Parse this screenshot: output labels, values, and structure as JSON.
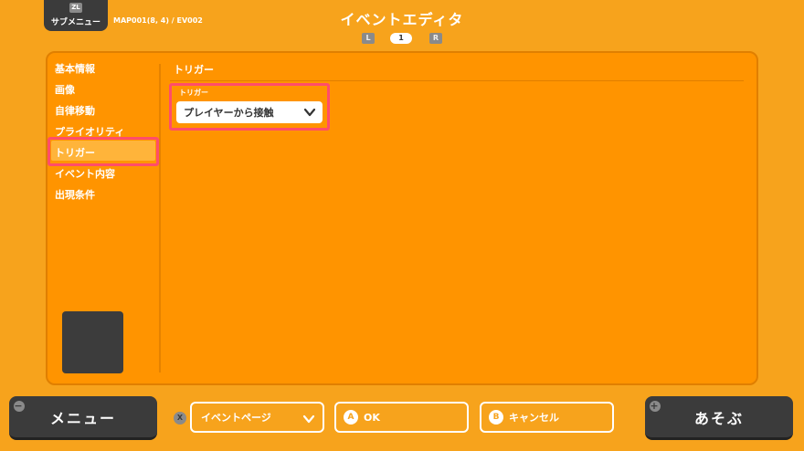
{
  "header": {
    "submenu_key": "ZL",
    "submenu_label": "サブメニュー",
    "map_info": "MAP001(8, 4) / EV002",
    "title": "イベントエディタ",
    "page_prev_key": "L",
    "page_number": "1",
    "page_next_key": "R"
  },
  "sidebar": {
    "items": [
      {
        "label": "基本情報"
      },
      {
        "label": "画像"
      },
      {
        "label": "自律移動"
      },
      {
        "label": "プライオリティ"
      },
      {
        "label": "トリガー"
      },
      {
        "label": "イベント内容"
      },
      {
        "label": "出現条件"
      }
    ],
    "selected_index": 4
  },
  "main": {
    "section_title": "トリガー",
    "trigger": {
      "label": "トリガー",
      "value": "プレイヤーから接触"
    }
  },
  "footer": {
    "menu_key": "−",
    "menu_label": "メニュー",
    "x_key": "X",
    "event_page_label": "イベントページ",
    "ok_key": "A",
    "ok_label": "OK",
    "cancel_key": "B",
    "cancel_label": "キャンセル",
    "play_key": "+",
    "play_label": "あそぶ"
  },
  "colors": {
    "background": "#f7a31c",
    "panel": "#ff9400",
    "highlight": "#ff4d6a",
    "dark_button": "#3b3b3b"
  }
}
